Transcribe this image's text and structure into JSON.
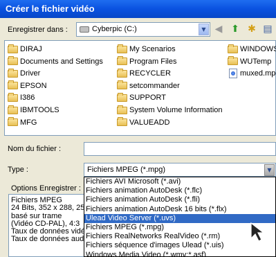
{
  "window": {
    "title": "Créer le fichier vidéo"
  },
  "save_in": {
    "label": "Enregistrer dans :",
    "value": "Cyberpic (C:)"
  },
  "files": [
    {
      "name": "DIRAJ",
      "kind": "folder"
    },
    {
      "name": "Documents and Settings",
      "kind": "folder"
    },
    {
      "name": "Driver",
      "kind": "folder"
    },
    {
      "name": "EPSON",
      "kind": "folder"
    },
    {
      "name": "I386",
      "kind": "folder"
    },
    {
      "name": "IBMTOOLS",
      "kind": "folder"
    },
    {
      "name": "MFG",
      "kind": "folder"
    },
    {
      "name": "My Scenarios",
      "kind": "folder"
    },
    {
      "name": "Program Files",
      "kind": "folder"
    },
    {
      "name": "RECYCLER",
      "kind": "folder"
    },
    {
      "name": "setcommander",
      "kind": "folder"
    },
    {
      "name": "SUPPORT",
      "kind": "folder"
    },
    {
      "name": "System Volume Information",
      "kind": "folder"
    },
    {
      "name": "VALUEADD",
      "kind": "folder"
    },
    {
      "name": "WINDOWS",
      "kind": "folder"
    },
    {
      "name": "WUTemp",
      "kind": "folder"
    },
    {
      "name": "muxed.mpg",
      "kind": "file"
    }
  ],
  "filename": {
    "label": "Nom du fichier :",
    "value": ""
  },
  "type": {
    "label": "Type :",
    "value": "Fichiers MPEG (*.mpg)"
  },
  "type_options": [
    "Fichiers AVI Microsoft (*.avi)",
    "Fichiers animation AutoDesk (*.flc)",
    "Fichiers animation AutoDesk (*.fli)",
    "Fichiers animation AutoDesk 16 bits (*.flx)",
    "Ulead Video Server (*.uvs)",
    "Fichiers MPEG (*.mpg)",
    "Fichiers RealNetworks RealVideo (*.rm)",
    "Fichiers séquence d'images Ulead (*.uis)",
    "Windows Media Video (*.wmv;*.asf)"
  ],
  "selected_option_index": 4,
  "save_options": {
    "label": "Options Enregistrer :",
    "lines": [
      "Fichiers MPEG",
      "24 Bits, 352 x 288, 25",
      "basé sur trame",
      "(Vidéo CD-PAL), 4:3",
      "Taux de données vidéo",
      "Taux de données audio"
    ]
  }
}
